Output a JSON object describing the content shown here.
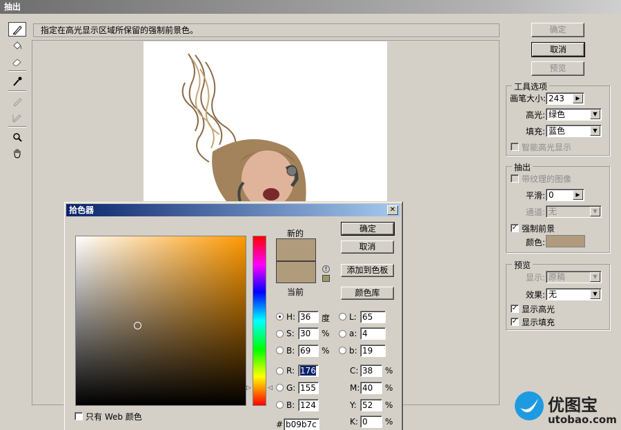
{
  "window": {
    "title": "抽出"
  },
  "toolbar": {
    "tools": [
      "edge-highlighter-icon",
      "fill-bucket-icon",
      "eraser-icon",
      "eyedropper-icon",
      "cleanup-tool-icon",
      "edge-touchup-icon",
      "zoom-icon",
      "hand-icon"
    ]
  },
  "hint": "指定在高光显示区域所保留的强制前景色。",
  "buttons": {
    "ok": "确定",
    "cancel": "取消",
    "preview": "预览"
  },
  "tool_options": {
    "legend": "工具选项",
    "brush_size_label": "画笔大小:",
    "brush_size": "243",
    "highlight_label": "高光:",
    "highlight_value": "绿色",
    "fill_label": "填充:",
    "fill_value": "蓝色",
    "smart_highlight_label": "智能高光显示"
  },
  "extraction": {
    "legend": "抽出",
    "textured_label": "带纹理的图像",
    "smooth_label": "平滑:",
    "smooth_value": "0",
    "channel_label": "通道:",
    "channel_value": "无",
    "force_fg_label": "强制前景",
    "color_label": "颜色:",
    "color": "#b09b7c"
  },
  "preview_group": {
    "legend": "预览",
    "show_label": "显示:",
    "show_value": "原稿",
    "effect_label": "效果:",
    "effect_value": "无",
    "show_highlight_label": "显示高光",
    "show_fill_label": "显示填充"
  },
  "picker": {
    "title": "拾色器",
    "new_label": "新的",
    "current_label": "当前",
    "ok": "确定",
    "cancel": "取消",
    "add_swatch": "添加到色板",
    "color_lib": "颜色库",
    "web_only": "只有 Web 颜色",
    "h_label": "H:",
    "h": "36",
    "h_unit": "度",
    "s_label": "S:",
    "s": "30",
    "s_unit": "%",
    "b_label": "B:",
    "b": "69",
    "b_unit": "%",
    "r_label": "R:",
    "r": "176",
    "g_label": "G:",
    "g": "155",
    "bb_label": "B:",
    "bb": "124",
    "l_label": "L:",
    "l": "65",
    "a_label": "a:",
    "a": "4",
    "lab_b_label": "b:",
    "lab_b": "19",
    "c_label": "C:",
    "c": "38",
    "m_label": "M:",
    "m": "40",
    "y_label": "Y:",
    "y": "52",
    "k_label": "K:",
    "k": "0",
    "pct": "%",
    "hex_label": "#",
    "hex": "b09b7c"
  },
  "watermark": {
    "brand": "优图宝",
    "domain": "utobao.com"
  }
}
